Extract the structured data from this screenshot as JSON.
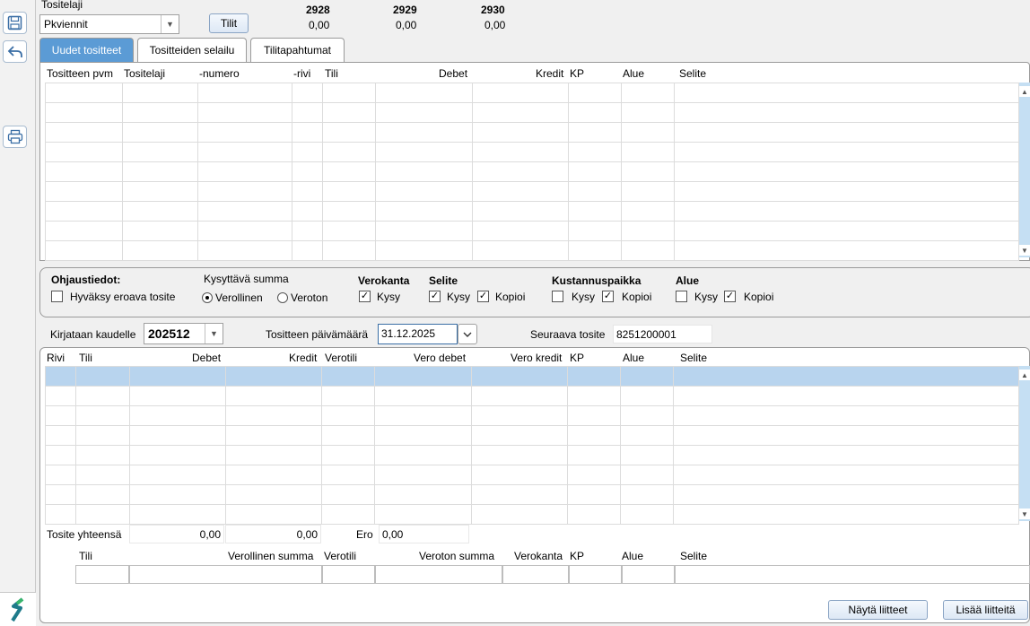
{
  "sidebar": {
    "icons": [
      "save-icon",
      "undo-icon",
      "print-icon"
    ],
    "logo": "app-logo"
  },
  "top": {
    "tositelaji_label": "Tositelaji",
    "tositelaji_value": "Pkviennit",
    "tilit_button": "Tilit",
    "accounts": [
      {
        "code": "2928",
        "balance": "0,00"
      },
      {
        "code": "2929",
        "balance": "0,00"
      },
      {
        "code": "2930",
        "balance": "0,00"
      }
    ]
  },
  "tabs": [
    "Uudet tositteet",
    "Tositteiden selailu",
    "Tilitapahtumat"
  ],
  "upper_grid": {
    "headers": [
      "Tositteen pvm",
      "Tositelaji",
      "-numero",
      "-rivi",
      "Tili",
      "Debet",
      "Kredit",
      "KP",
      "Alue",
      "Selite"
    ]
  },
  "options": {
    "ohjaustiedot": "Ohjaustiedot:",
    "hyvaksy": "Hyväksy eroava tosite",
    "kysyttava": "Kysyttävä summa",
    "verollinen": "Verollinen",
    "veroton": "Veroton",
    "verokanta": "Verokanta",
    "selite": "Selite",
    "kustannuspaikka": "Kustannuspaikka",
    "alue": "Alue",
    "kysy": "Kysy",
    "kopioi": "Kopioi"
  },
  "posting": {
    "kausi_label": "Kirjataan kaudelle",
    "kausi_value": "202512",
    "pvm_label": "Tositteen päivämäärä",
    "pvm_value": "31.12.2025",
    "seuraava_label": "Seuraava tosite",
    "seuraava_value": "8251200001"
  },
  "lower_grid": {
    "headers": [
      "Rivi",
      "Tili",
      "Debet",
      "Kredit",
      "Verotili",
      "Vero debet",
      "Vero kredit",
      "KP",
      "Alue",
      "Selite"
    ]
  },
  "totals": {
    "label": "Tosite yhteensä",
    "debet": "0,00",
    "kredit": "0,00",
    "ero_label": "Ero",
    "ero": "0,00"
  },
  "entry": {
    "headers": [
      "Tili",
      "Verollinen summa",
      "Verotili",
      "Veroton summa",
      "Verokanta",
      "KP",
      "Alue",
      "Selite"
    ]
  },
  "buttons": {
    "nayta": "Näytä liitteet",
    "lisaa": "Lisää liitteitä"
  }
}
